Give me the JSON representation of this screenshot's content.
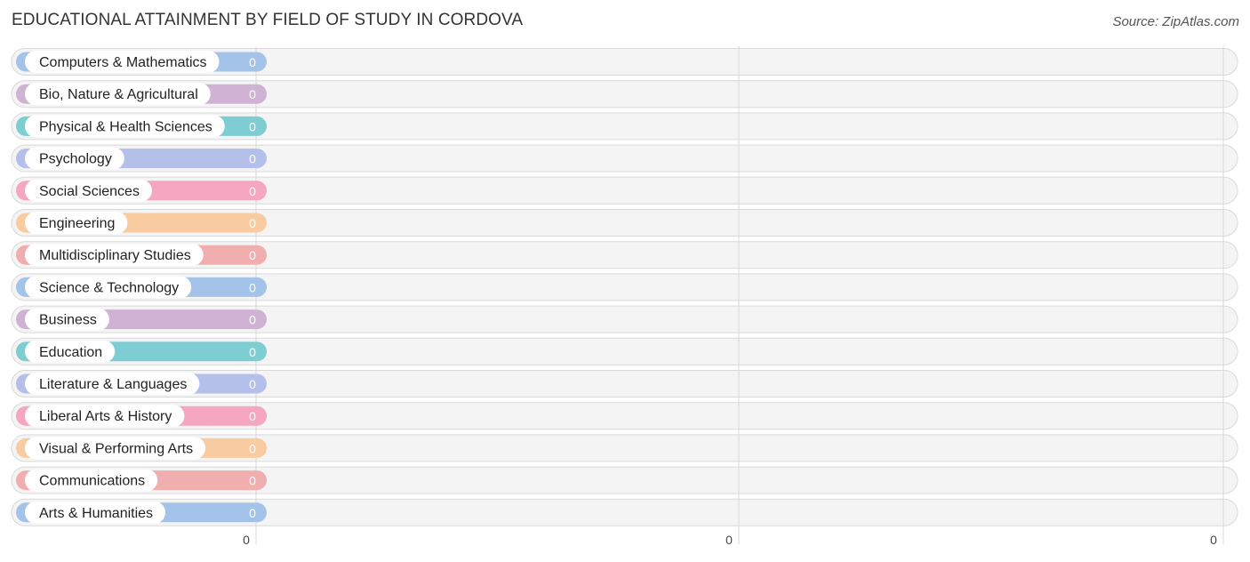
{
  "chart_data": {
    "type": "bar",
    "orientation": "horizontal",
    "title": "EDUCATIONAL ATTAINMENT BY FIELD OF STUDY IN CORDOVA",
    "source": "Source: ZipAtlas.com",
    "xlabel": "",
    "ylabel": "",
    "grid": true,
    "legend": "none",
    "xlim": [
      0,
      0
    ],
    "x_ticks": [
      "0",
      "0",
      "0"
    ],
    "categories": [
      "Computers & Mathematics",
      "Bio, Nature & Agricultural",
      "Physical & Health Sciences",
      "Psychology",
      "Social Sciences",
      "Engineering",
      "Multidisciplinary Studies",
      "Science & Technology",
      "Business",
      "Education",
      "Literature & Languages",
      "Liberal Arts & History",
      "Visual & Performing Arts",
      "Communications",
      "Arts & Humanities"
    ],
    "values": [
      0,
      0,
      0,
      0,
      0,
      0,
      0,
      0,
      0,
      0,
      0,
      0,
      0,
      0,
      0
    ],
    "value_labels": [
      "0",
      "0",
      "0",
      "0",
      "0",
      "0",
      "0",
      "0",
      "0",
      "0",
      "0",
      "0",
      "0",
      "0",
      "0"
    ],
    "colors": [
      "#a4c3e8",
      "#cfb2d4",
      "#7ecdd2",
      "#b4bfea",
      "#f5a6c0",
      "#f9cba0",
      "#f0aeae",
      "#a4c3e8",
      "#cfb2d4",
      "#7ecdd2",
      "#b4bfea",
      "#f5a6c0",
      "#f9cba0",
      "#f0aeae",
      "#a4c3e8"
    ]
  }
}
